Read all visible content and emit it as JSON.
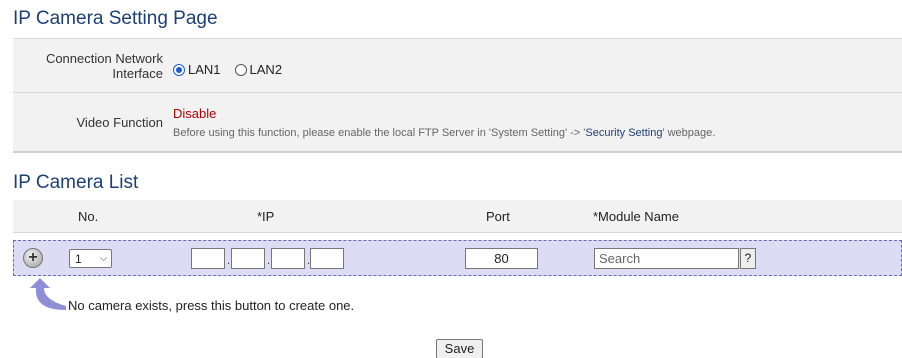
{
  "setting": {
    "title": "IP Camera Setting Page",
    "connection_label": "Connection Network Interface",
    "lan1": "LAN1",
    "lan2": "LAN2",
    "video_label": "Video Function",
    "video_status": "Disable",
    "note_prefix": "Before using this function, please enable the local FTP Server in 'System Setting' -> '",
    "note_link": "Security Setting",
    "note_suffix": "' webpage."
  },
  "list": {
    "title": "IP Camera List",
    "headers": {
      "no": "No.",
      "ip": "*IP",
      "port": "Port",
      "module": "*Module Name"
    },
    "row": {
      "no_value": "1",
      "port_value": "80",
      "module_placeholder": "Search",
      "help_label": "?",
      "add_label": "+"
    },
    "hint": "No camera exists, press this button to create one."
  },
  "save_label": "Save",
  "colors": {
    "accent": "#1c3f78",
    "status_disable": "#b20000",
    "row_bg": "#dddcf5",
    "arrow": "#8f8fd8"
  }
}
